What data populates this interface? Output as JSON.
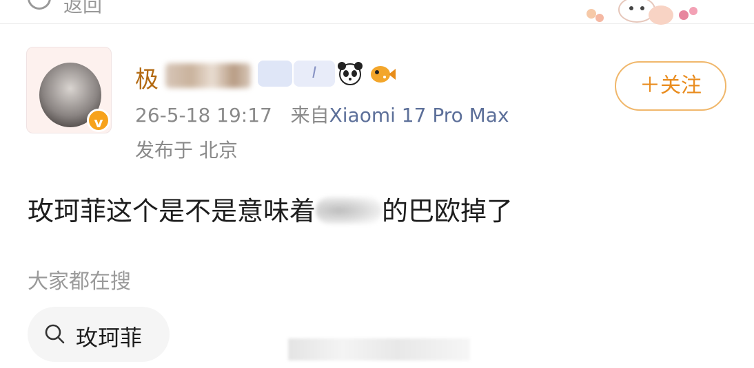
{
  "top_bar": {
    "back_label": "返回"
  },
  "user": {
    "name_visible_char": "极",
    "badge_text": "I",
    "verified_mark": "v"
  },
  "post": {
    "timestamp": "26-5-18 19:17",
    "source_prefix": "来自",
    "device": "Xiaomi 17 Pro Max",
    "location": "发布于 北京",
    "text_before": "玫珂菲这个是不是意味着",
    "text_after": "的巴欧掉了"
  },
  "follow_button": {
    "label": "＋关注"
  },
  "search": {
    "heading": "大家都在搜",
    "chip_label": "玫珂菲"
  },
  "colors": {
    "accent": "#e98c1e",
    "name_color": "#b36a12",
    "device_color": "#5c6f99",
    "meta_gray": "#8a8a8a"
  }
}
